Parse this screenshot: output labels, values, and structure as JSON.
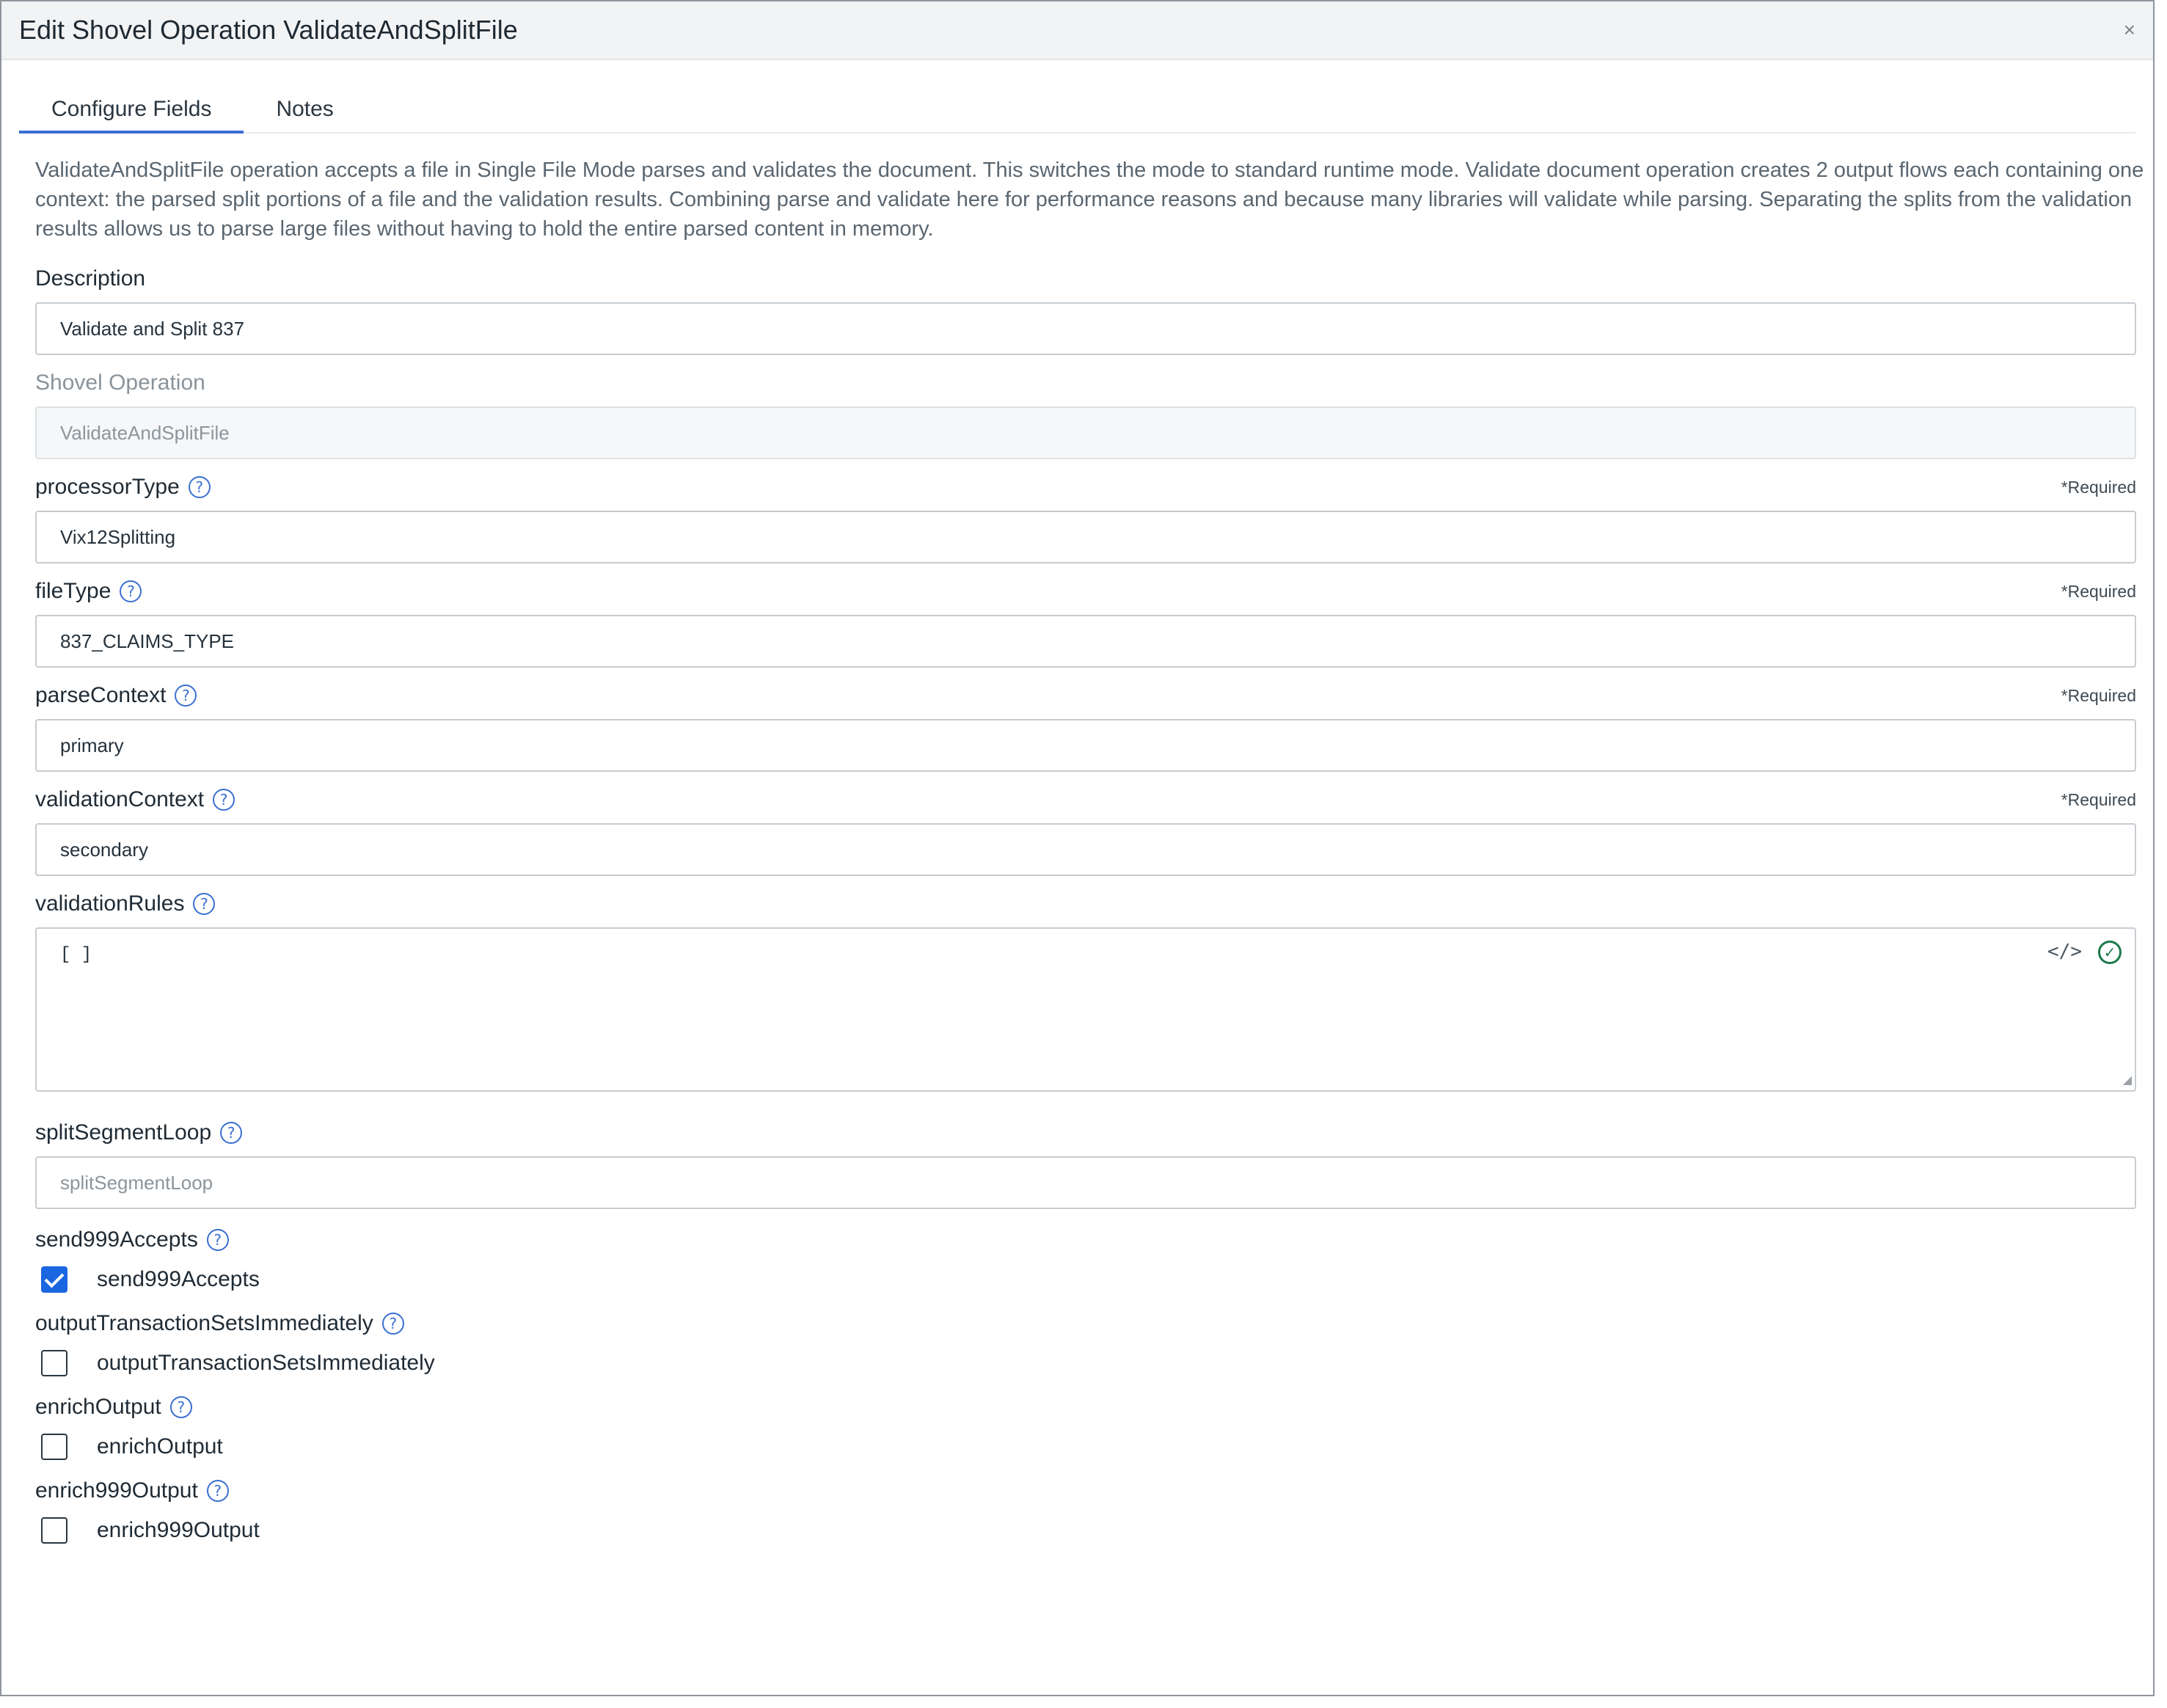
{
  "dialog": {
    "title": "Edit Shovel Operation ValidateAndSplitFile",
    "close_glyph": "×"
  },
  "tabs": [
    {
      "label": "Configure Fields",
      "active": true
    },
    {
      "label": "Notes",
      "active": false
    }
  ],
  "intro": "ValidateAndSplitFile operation accepts a file in Single File Mode parses and validates the document. This switches the mode to standard runtime mode. Validate document operation creates 2 output flows each containing one context: the parsed split portions of a file and the validation results. Combining parse and validate here for performance reasons and because many libraries will validate while parsing. Separating the splits from the validation results allows us to parse large files without having to hold the entire parsed content in memory.",
  "required_text": "*Required",
  "fields": {
    "description": {
      "label": "Description",
      "value": "Validate and Split 837"
    },
    "shovel_operation": {
      "label": "Shovel Operation",
      "placeholder": "ValidateAndSplitFile"
    },
    "processor_type": {
      "label": "processorType",
      "value": "Vix12Splitting"
    },
    "file_type": {
      "label": "fileType",
      "value": "837_CLAIMS_TYPE"
    },
    "parse_context": {
      "label": "parseContext",
      "value": "primary"
    },
    "validation_context": {
      "label": "validationContext",
      "value": "secondary"
    },
    "validation_rules": {
      "label": "validationRules",
      "value": "[ ]",
      "code_icon": "</>",
      "check_icon": "✓"
    },
    "split_segment_loop": {
      "label": "splitSegmentLoop",
      "placeholder": "splitSegmentLoop"
    }
  },
  "checkbox_fields": [
    {
      "label": "send999Accepts",
      "checkbox_label": "send999Accepts",
      "checked": true
    },
    {
      "label": "outputTransactionSetsImmediately",
      "checkbox_label": "outputTransactionSetsImmediately",
      "checked": false
    },
    {
      "label": "enrichOutput",
      "checkbox_label": "enrichOutput",
      "checked": false
    },
    {
      "label": "enrich999Output",
      "checkbox_label": "enrich999Output",
      "checked": false
    }
  ],
  "help_glyph": "?",
  "colors": {
    "accent": "#3a6fd1",
    "checkbox_checked": "#1a66e0",
    "valid_check": "#1d7a4a"
  }
}
